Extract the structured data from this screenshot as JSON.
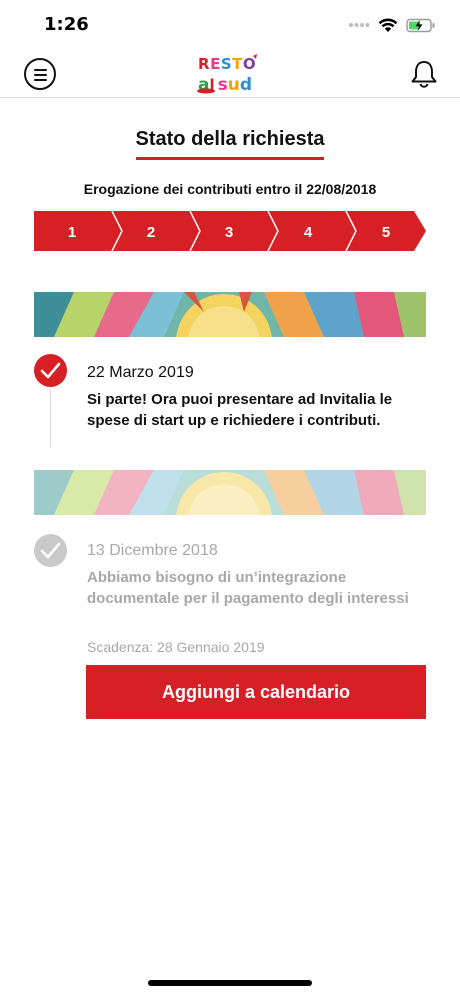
{
  "status_bar": {
    "time": "1:26",
    "icons": [
      "signal-icon",
      "wifi-icon",
      "battery-charging-icon"
    ]
  },
  "header": {
    "menu_icon": "hamburger-menu-icon",
    "logo": {
      "line1": "RESTO",
      "line2": "al sud"
    },
    "bell_icon": "bell-icon"
  },
  "page": {
    "title": "Stato della richiesta",
    "subtitle": "Erogazione dei contributi entro il 22/08/2018"
  },
  "steps": [
    "1",
    "2",
    "3",
    "4",
    "5"
  ],
  "timeline": [
    {
      "status": "active",
      "date": "22 Marzo 2019",
      "text": "Si parte! Ora puoi presentare ad Invitalia le spese di start up e richiedere i contributi."
    },
    {
      "status": "done",
      "date": "13 Dicembre 2018",
      "text": "Abbiamo bisogno di un’integrazione documentale per il pagamento degli interessi",
      "deadline": "Scadenza: 28 Gennaio 2019",
      "button_label": "Aggiungi a calendario"
    }
  ],
  "colors": {
    "accent": "#d71f26",
    "muted_text": "#a8a8a8",
    "muted_check": "#c9c9c9",
    "divider": "#dcdcdc"
  }
}
